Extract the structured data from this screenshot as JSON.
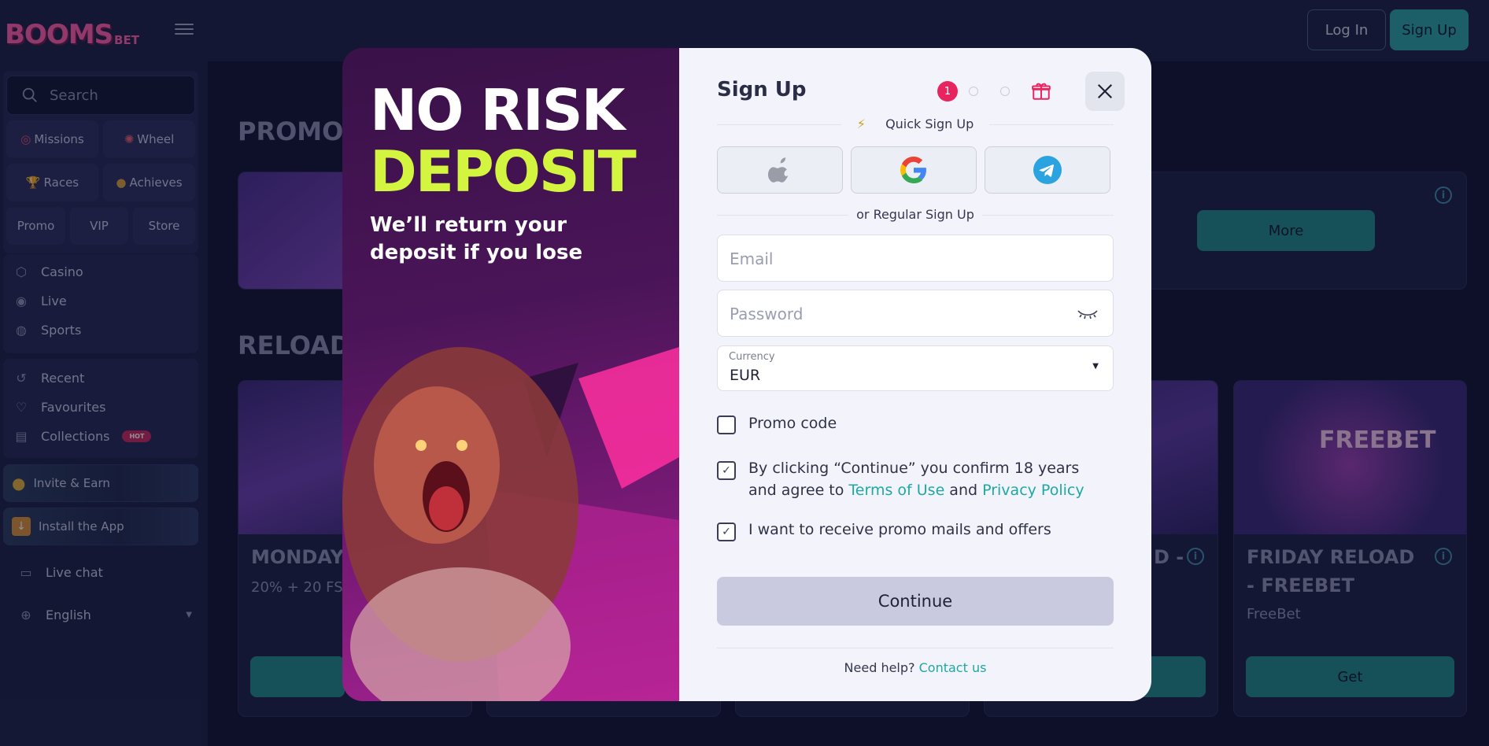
{
  "brand": {
    "logo_text": "BOOMS",
    "logo_sub": "BET",
    "accent": "#2aa5a5",
    "pink": "#ff5fa8"
  },
  "header": {
    "login_label": "Log In",
    "signup_label": "Sign Up"
  },
  "sidebar": {
    "search_placeholder": "Search",
    "tiles": [
      {
        "label": "Missions",
        "icon": "target-icon"
      },
      {
        "label": "Wheel",
        "icon": "wheel-icon"
      },
      {
        "label": "Races",
        "icon": "trophy-icon"
      },
      {
        "label": "Achieves",
        "icon": "medal-icon"
      },
      {
        "label": "Promo"
      },
      {
        "label": "VIP"
      },
      {
        "label": "Store"
      }
    ],
    "main_nav": [
      {
        "label": "Casino",
        "icon": "casino-icon"
      },
      {
        "label": "Live",
        "icon": "live-icon"
      },
      {
        "label": "Sports",
        "icon": "sports-icon"
      }
    ],
    "user_nav": [
      {
        "label": "Recent",
        "icon": "history-icon"
      },
      {
        "label": "Favourites",
        "icon": "heart-icon"
      },
      {
        "label": "Collections",
        "icon": "book-icon",
        "badge": "HOT"
      }
    ],
    "invite_label": "Invite & Earn",
    "install_label": "Install the App",
    "live_chat_label": "Live chat",
    "language_label": "English"
  },
  "main": {
    "promo_section_title": "PROMOTIONS",
    "more_label": "More",
    "reload_section_title": "RELOAD",
    "cards": [
      {
        "title": "MONDAY",
        "subtitle": "20% + 20 FS"
      },
      {
        "title": "D -",
        "subtitle": ""
      },
      {
        "title": "FRIDAY RELOAD - FREEBET",
        "subtitle": "FreeBet",
        "button": "Get",
        "art_text": "FREEBET"
      }
    ]
  },
  "modal": {
    "headline_1": "NO RISK",
    "headline_2": "DEPOSIT",
    "tagline": "We’ll return your deposit if you lose",
    "title": "Sign Up",
    "step_active": "1",
    "quick_label": "Quick Sign Up",
    "regular_label": "or Regular Sign Up",
    "email_placeholder": "Email",
    "password_placeholder": "Password",
    "currency_label": "Currency",
    "currency_value": "EUR",
    "promo_code_label": "Promo code",
    "terms_text_1": "By clicking “Continue” you confirm 18 years and agree to ",
    "terms_link": "Terms of Use",
    "terms_and": " and ",
    "privacy_link": "Privacy Policy",
    "promo_mails_label": "I want to receive promo mails and offers",
    "continue_label": "Continue",
    "help_text": "Need help?",
    "contact_link": "Contact us"
  }
}
